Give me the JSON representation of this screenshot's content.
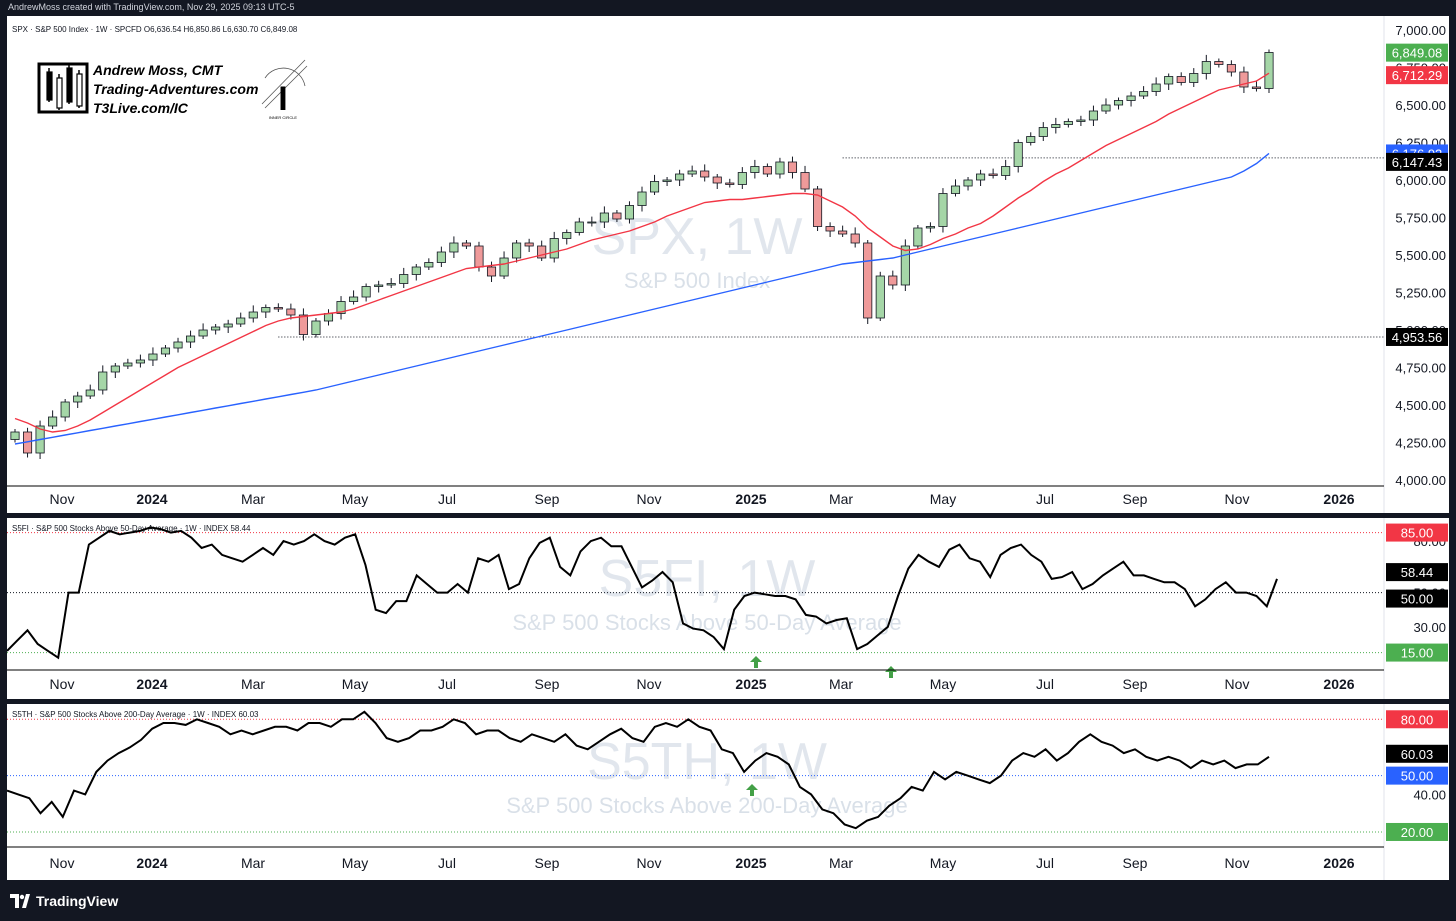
{
  "header": {
    "created_text": "AndrewMoss created with TradingView.com, Nov 29, 2025 09:13 UTC-5"
  },
  "footer": {
    "brand": "TradingView"
  },
  "branding": {
    "author": "Andrew Moss, CMT",
    "site": "Trading-Adventures.com",
    "affiliation": "T3Live.com/IC",
    "badge_text": "INNER CIRCLE"
  },
  "colors": {
    "up": "#a5d6a7",
    "up_border": "#26a69a",
    "down": "#ef9a9a",
    "down_border": "#e57373",
    "sma_fast": "#f23645",
    "sma_slow": "#2962ff",
    "label_green": "#4caf50",
    "label_red": "#f23645",
    "label_blue": "#2962ff",
    "watermark": "#c9d3df"
  },
  "xaxis": {
    "labels": [
      "Nov",
      "2024",
      "Mar",
      "May",
      "Jul",
      "Sep",
      "Nov",
      "2025",
      "Mar",
      "May",
      "Jul",
      "Sep",
      "Nov",
      "2026"
    ],
    "bold": [
      false,
      true,
      false,
      false,
      false,
      false,
      false,
      true,
      false,
      false,
      false,
      false,
      false,
      true
    ]
  },
  "chart_data": [
    {
      "type": "candlestick",
      "panel": "price",
      "legend": "SPX · S&P 500 Index · 1W · SPCFD  O6,636.54  H6,850.86  L6,630.70  C6,849.08",
      "watermark_title": "SPX, 1W",
      "watermark_subtitle": "S&P 500 Index",
      "y_ticks": [
        "7,000.00",
        "6,750.00",
        "6,500.00",
        "6,250.00",
        "6,000.00",
        "5,750.00",
        "5,500.00",
        "5,250.00",
        "5,000.00",
        "4,750.00",
        "4,500.00",
        "4,250.00",
        "4,000.00"
      ],
      "ylim": [
        3960,
        7040
      ],
      "last_close": 6849.08,
      "sma_fast_last": 6712.29,
      "sma_slow_last": 6176.93,
      "level_lines": [
        6147.43,
        4953.56
      ],
      "price_labels": [
        "6,849.08",
        "6,712.29",
        "6,176.93",
        "6,147.43",
        "4,953.56"
      ],
      "closes": [
        4320,
        4180,
        4360,
        4420,
        4520,
        4560,
        4600,
        4720,
        4760,
        4780,
        4800,
        4840,
        4880,
        4920,
        4960,
        5000,
        5020,
        5040,
        5080,
        5120,
        5150,
        5140,
        5100,
        4970,
        5060,
        5110,
        5190,
        5220,
        5290,
        5300,
        5310,
        5370,
        5420,
        5450,
        5520,
        5580,
        5560,
        5420,
        5360,
        5480,
        5580,
        5560,
        5480,
        5610,
        5650,
        5720,
        5720,
        5780,
        5740,
        5830,
        5920,
        5990,
        6000,
        6040,
        6060,
        6020,
        5980,
        5970,
        6050,
        6090,
        6040,
        6120,
        6050,
        5940,
        5690,
        5660,
        5640,
        5580,
        5080,
        5360,
        5300,
        5560,
        5680,
        5690,
        5910,
        5960,
        6000,
        6040,
        6030,
        6090,
        6250,
        6290,
        6350,
        6370,
        6390,
        6400,
        6460,
        6500,
        6530,
        6560,
        6590,
        6640,
        6690,
        6650,
        6710,
        6790,
        6770,
        6720,
        6620,
        6610,
        6850
      ],
      "sma_fast": [
        4410,
        4380,
        4340,
        4320,
        4330,
        4360,
        4400,
        4450,
        4500,
        4550,
        4600,
        4650,
        4700,
        4750,
        4790,
        4830,
        4870,
        4910,
        4950,
        4990,
        5030,
        5060,
        5080,
        5090,
        5100,
        5110,
        5120,
        5140,
        5170,
        5200,
        5230,
        5260,
        5290,
        5320,
        5350,
        5380,
        5410,
        5420,
        5430,
        5440,
        5460,
        5480,
        5500,
        5520,
        5540,
        5570,
        5600,
        5620,
        5640,
        5660,
        5690,
        5720,
        5760,
        5790,
        5820,
        5850,
        5860,
        5870,
        5870,
        5880,
        5890,
        5900,
        5910,
        5910,
        5900,
        5860,
        5820,
        5760,
        5680,
        5620,
        5560,
        5530,
        5540,
        5570,
        5610,
        5640,
        5680,
        5710,
        5760,
        5820,
        5880,
        5930,
        5990,
        6040,
        6080,
        6130,
        6180,
        6230,
        6270,
        6310,
        6350,
        6390,
        6440,
        6480,
        6520,
        6560,
        6600,
        6620,
        6640,
        6660,
        6712
      ],
      "sma_slow": [
        4240,
        4255,
        4270,
        4285,
        4300,
        4315,
        4330,
        4345,
        4360,
        4375,
        4390,
        4405,
        4420,
        4435,
        4450,
        4465,
        4480,
        4495,
        4510,
        4525,
        4540,
        4555,
        4570,
        4585,
        4600,
        4620,
        4640,
        4660,
        4680,
        4700,
        4720,
        4740,
        4760,
        4780,
        4800,
        4820,
        4840,
        4860,
        4880,
        4900,
        4920,
        4940,
        4960,
        4980,
        5000,
        5020,
        5040,
        5060,
        5080,
        5100,
        5120,
        5140,
        5160,
        5180,
        5200,
        5220,
        5240,
        5260,
        5280,
        5300,
        5320,
        5340,
        5360,
        5380,
        5400,
        5420,
        5440,
        5450,
        5460,
        5470,
        5480,
        5500,
        5520,
        5540,
        5560,
        5580,
        5600,
        5620,
        5640,
        5660,
        5680,
        5700,
        5720,
        5740,
        5760,
        5780,
        5800,
        5820,
        5840,
        5860,
        5880,
        5900,
        5920,
        5940,
        5960,
        5980,
        6000,
        6020,
        6060,
        6110,
        6177
      ]
    },
    {
      "type": "line",
      "panel": "s5fi",
      "legend": "S5FI · S&P 500 Stocks Above 50-Day Average · 1W · INDEX  58.44",
      "watermark_title": "S5FI, 1W",
      "watermark_subtitle": "S&P 500 Stocks Above 50-Day Average",
      "y_ticks": [
        "80.00",
        "50.00",
        "30.00"
      ],
      "ylim": [
        6,
        90
      ],
      "last": 58.44,
      "levels": [
        85,
        50,
        15
      ],
      "labels": [
        "85.00",
        "58.44",
        "50.00",
        "15.00"
      ],
      "values": [
        16,
        22,
        28,
        20,
        16,
        12,
        50,
        50,
        78,
        82,
        86,
        84,
        85,
        86,
        88,
        87,
        85,
        86,
        82,
        76,
        78,
        72,
        70,
        68,
        72,
        76,
        72,
        80,
        78,
        80,
        84,
        80,
        78,
        82,
        84,
        66,
        40,
        38,
        45,
        45,
        60,
        55,
        50,
        50,
        55,
        50,
        70,
        68,
        72,
        52,
        55,
        70,
        79,
        82,
        65,
        60,
        74,
        80,
        82,
        77,
        77,
        65,
        53,
        57,
        62,
        56,
        32,
        29,
        28,
        24,
        17,
        40,
        48,
        50,
        49,
        48,
        48,
        46,
        37,
        36,
        32,
        34,
        35,
        17,
        20,
        25,
        30,
        48,
        64,
        72,
        68,
        65,
        75,
        78,
        70,
        68,
        59,
        72,
        76,
        78,
        72,
        68,
        58,
        59,
        62,
        52,
        55,
        60,
        64,
        68,
        60,
        60,
        58,
        56,
        56,
        52,
        42,
        46,
        52,
        56,
        50,
        50,
        48,
        42,
        58
      ]
    },
    {
      "type": "line",
      "panel": "s5th",
      "legend": "S5TH · S&P 500 Stocks Above 200-Day Average · 1W · INDEX  60.03",
      "watermark_title": "S5TH, 1W",
      "watermark_subtitle": "S&P 500 Stocks Above 200-Day Average",
      "y_ticks": [
        "40.00"
      ],
      "ylim": [
        12,
        86
      ],
      "last": 60.03,
      "levels": [
        80,
        50,
        20
      ],
      "labels": [
        "80.00",
        "60.03",
        "50.00",
        "20.00"
      ],
      "values": [
        42,
        40,
        38,
        30,
        36,
        28,
        42,
        40,
        52,
        58,
        62,
        65,
        69,
        75,
        78,
        78,
        77,
        80,
        78,
        76,
        72,
        74,
        72,
        74,
        76,
        76,
        74,
        78,
        78,
        76,
        80,
        80,
        84,
        78,
        70,
        68,
        70,
        74,
        74,
        76,
        80,
        78,
        72,
        74,
        74,
        70,
        68,
        72,
        70,
        68,
        72,
        66,
        64,
        68,
        72,
        75,
        70,
        68,
        76,
        78,
        76,
        80,
        76,
        74,
        64,
        62,
        52,
        58,
        62,
        60,
        56,
        44,
        40,
        32,
        30,
        24,
        22,
        26,
        28,
        34,
        38,
        44,
        42,
        52,
        48,
        52,
        50,
        48,
        46,
        50,
        58,
        62,
        60,
        64,
        58,
        62,
        68,
        72,
        68,
        66,
        62,
        64,
        60,
        58,
        60,
        58,
        54,
        58,
        56,
        58,
        54,
        56,
        56,
        60
      ]
    }
  ]
}
